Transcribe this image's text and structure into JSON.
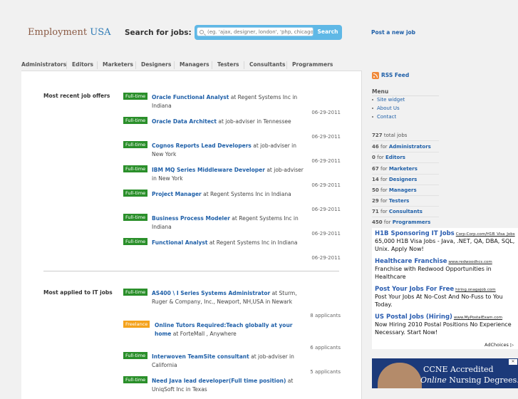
{
  "header": {
    "logo_main": "Employment",
    "logo_accent": "USA",
    "search_label": "Search for jobs:",
    "search_placeholder": "(eg. 'ajax, designer, london', 'php, chicago')",
    "search_button": "Search",
    "post_job": "Post a new job"
  },
  "nav": {
    "items": [
      "Administrators",
      "Editors",
      "Marketers",
      "Designers",
      "Managers",
      "Testers",
      "Consultants",
      "Programmers"
    ]
  },
  "recent": {
    "title": "Most recent job offers",
    "jobs": [
      {
        "badge": "Full-time",
        "title": "Oracle Functional Analyst",
        "rest": " at Regent Systems Inc in Indiana",
        "meta": "06-29-2011"
      },
      {
        "badge": "Full-time",
        "title": "Oracle Data Architect",
        "rest": " at job-adviser in Tennessee",
        "meta": "06-29-2011"
      },
      {
        "badge": "Full-time",
        "title": "Cognos Reports Lead Developers",
        "rest": " at job-adviser in New York",
        "meta": "06-29-2011"
      },
      {
        "badge": "Full-time",
        "title": "IBM MQ Series Middleware Developer",
        "rest": " at job-adviser in New York",
        "meta": "06-29-2011"
      },
      {
        "badge": "Full-time",
        "title": "Project Manager",
        "rest": " at Regent Systems Inc in Indiana",
        "meta": "06-29-2011"
      },
      {
        "badge": "Full-time",
        "title": "Business Process Modeler",
        "rest": " at Regent Systems Inc in Indiana",
        "meta": "06-29-2011"
      },
      {
        "badge": "Full-time",
        "title": "Functional Analyst",
        "rest": " at Regent Systems Inc in Indiana",
        "meta": "06-29-2011"
      }
    ]
  },
  "applied": {
    "title": "Most applied to IT jobs",
    "jobs": [
      {
        "badge": "Full-time",
        "title": "AS400 \\ I Series Systems Administrator",
        "rest": " at Sturm, Ruger & Company, Inc., Newport, NH,USA in Newark",
        "meta": "8 applicants"
      },
      {
        "badge": "Freelance",
        "title": "Online Tutors Required:Teach globally at your home",
        "rest": " at ForteMall , Anywhere",
        "meta": "6 applicants"
      },
      {
        "badge": "Full-time",
        "title": "Interwoven TeamSite consultant",
        "rest": " at job-adviser in California",
        "meta": "5 applicants"
      },
      {
        "badge": "Full-time",
        "title": "Need Java lead developer(Full time position)",
        "rest": " at UniqSoft Inc in Texas",
        "meta": ""
      }
    ]
  },
  "sidebar": {
    "rss": "RSS Feed",
    "menu_heading": "Menu",
    "menu_items": [
      "Site widget",
      "About Us",
      "Contact"
    ],
    "total": {
      "count": "727",
      "label": "total jobs"
    },
    "stats": [
      {
        "count": "46",
        "cat": "Administrators"
      },
      {
        "count": "0",
        "cat": "Editors"
      },
      {
        "count": "67",
        "cat": "Marketers"
      },
      {
        "count": "14",
        "cat": "Designers"
      },
      {
        "count": "50",
        "cat": "Managers"
      },
      {
        "count": "29",
        "cat": "Testers"
      },
      {
        "count": "71",
        "cat": "Consultants"
      },
      {
        "count": "450",
        "cat": "Programmers"
      }
    ],
    "stat_for": "for",
    "ads": [
      {
        "title": "H1B Sponsoring IT Jobs",
        "url": "Corp-Corp.com/H1B_Visa_Jobs",
        "body": "65,000 H1B Visa Jobs - Java, .NET, QA, DBA, SQL, Unix. Apply Now!"
      },
      {
        "title": "Healthcare Franchise",
        "url": "www.redwoodhcs.com",
        "body": "Franchise with Redwood Opportunities in Healthcare"
      },
      {
        "title": "Post Your Jobs For Free",
        "url": "hiring.onagajob.com",
        "body": "Post Your Jobs At No-Cost And No-Fuss to You Today."
      },
      {
        "title": "US Postal Jobs (Hiring)",
        "url": "www.MyPostalExam.com",
        "body": "Now Hiring 2010 Postal Positions No Experience Necessary. Start Now!"
      }
    ],
    "adchoices": "AdChoices",
    "banner_l1": "CCNE Accredited",
    "banner_l2_em": "Online",
    "banner_l2_rest": " Nursing Degrees."
  }
}
